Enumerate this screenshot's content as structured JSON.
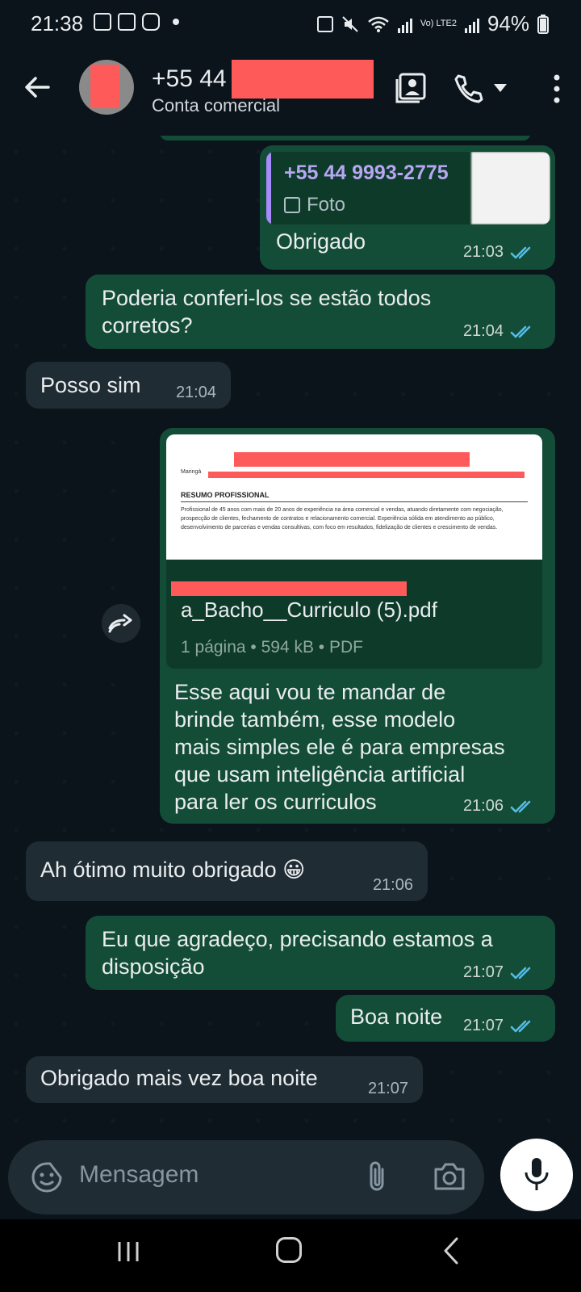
{
  "status_bar": {
    "time": "21:38",
    "battery": "94%",
    "network": "Vo) LTE2",
    "icons": [
      "image-icon",
      "tag-icon",
      "instagram-icon",
      "dot-icon",
      "recycle-icon",
      "mute-icon",
      "wifi-icon",
      "signal-icon",
      "battery-icon"
    ]
  },
  "header": {
    "name": "+55 44",
    "subtitle": "Conta comercial",
    "icons": [
      "back-arrow-icon",
      "contact-card-icon",
      "phone-icon",
      "dropdown-icon",
      "more-vert-icon"
    ]
  },
  "messages": [
    {
      "direction": "out",
      "reply_to": {
        "sender": "+55 44 9993-2775",
        "type_label": "Foto"
      },
      "text": "Obrigado",
      "time": "21:03",
      "status": "read"
    },
    {
      "direction": "out",
      "text_lines": [
        "Poderia conferi-los se estão todos",
        "corretos?"
      ],
      "time": "21:04",
      "status": "read"
    },
    {
      "direction": "in",
      "text": "Posso sim",
      "time": "21:04"
    },
    {
      "direction": "out",
      "document": {
        "preview": {
          "city": "Maringá",
          "heading": "RESUMO PROFISSIONAL",
          "body": "Profissional de 45 anos com mais de 20 anos de experiência na área comercial e vendas, atuando diretamente com negociação, prospecção de clientes, fechamento de contratos e relacionamento comercial. Experiência sólida em atendimento ao público, desenvolvimento de parcerias e vendas consultivas, com foco em resultados, fidelização de clientes e crescimento de vendas."
        },
        "filename": "a_Bacho__Curriculo (5).pdf",
        "info": "1 página • 594 kB • PDF"
      },
      "text_lines": [
        "Esse aqui vou te mandar de",
        "brinde também, esse modelo",
        "mais simples ele é para empresas",
        "que usam inteligência artificial",
        "para ler os curriculos"
      ],
      "time": "21:06",
      "status": "read"
    },
    {
      "direction": "in",
      "text": "Ah ótimo muito obrigado 😀",
      "time": "21:06"
    },
    {
      "direction": "out",
      "text_lines": [
        "Eu que agradeço, precisando estamos a",
        "disposição"
      ],
      "time": "21:07",
      "status": "read"
    },
    {
      "direction": "out",
      "text": "Boa noite",
      "time": "21:07",
      "status": "read"
    },
    {
      "direction": "in",
      "text": "Obrigado mais vez boa noite",
      "time": "21:07"
    }
  ],
  "input": {
    "placeholder": "Mensagem",
    "icons": [
      "emoji-sticker-icon",
      "attach-clip-icon",
      "camera-icon",
      "mic-icon"
    ]
  },
  "nav_bar": {
    "icons": [
      "recents-icon",
      "home-icon",
      "back-icon"
    ]
  },
  "colors": {
    "background": "#0b141a",
    "outgoing_bubble": "#144d37",
    "incoming_bubble": "#202c33",
    "read_ticks": "#53bdeb",
    "quote_accent": "#a78bfa",
    "redaction": "#ff5a5a"
  }
}
